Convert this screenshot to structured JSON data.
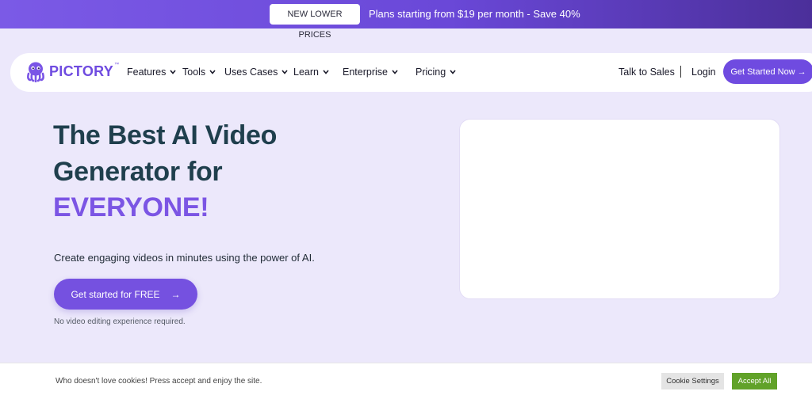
{
  "promo": {
    "badge": "NEW LOWER PRICES",
    "text": "Plans starting from $19 per month - Save 40%"
  },
  "nav": {
    "logo_text": "PICTORY",
    "logo_tm": "™",
    "items": [
      {
        "label": "Features",
        "icon": "chevron-down-icon"
      },
      {
        "label": "Tools",
        "icon": "chevron-down-icon"
      },
      {
        "label": "Uses Cases",
        "icon": "chevron-down-icon"
      },
      {
        "label": "Learn",
        "icon": "chevron-down-icon"
      },
      {
        "label": "Enterprise",
        "icon": "chevron-down-icon"
      },
      {
        "label": "Pricing",
        "icon": "chevron-down-icon"
      }
    ],
    "talk_to_sales": "Talk to Sales",
    "divider": "|",
    "login": "Login",
    "cta": "Get Started Now →"
  },
  "hero": {
    "line1": "The Best AI Video",
    "line2": "Generator for",
    "line3": "EVERYONE!",
    "subtitle": "Create engaging videos in minutes using the power of AI.",
    "cta": "Get started for FREE",
    "cta_arrow": "→",
    "note": "No video editing experience required."
  },
  "cookie": {
    "text": "Who doesn't love cookies! Press accept and enjoy the site.",
    "settings": "Cookie Settings",
    "accept": "Accept All"
  },
  "colors": {
    "brand": "#6f4be0",
    "background": "#ece8fb",
    "accept_green": "#61a229"
  }
}
